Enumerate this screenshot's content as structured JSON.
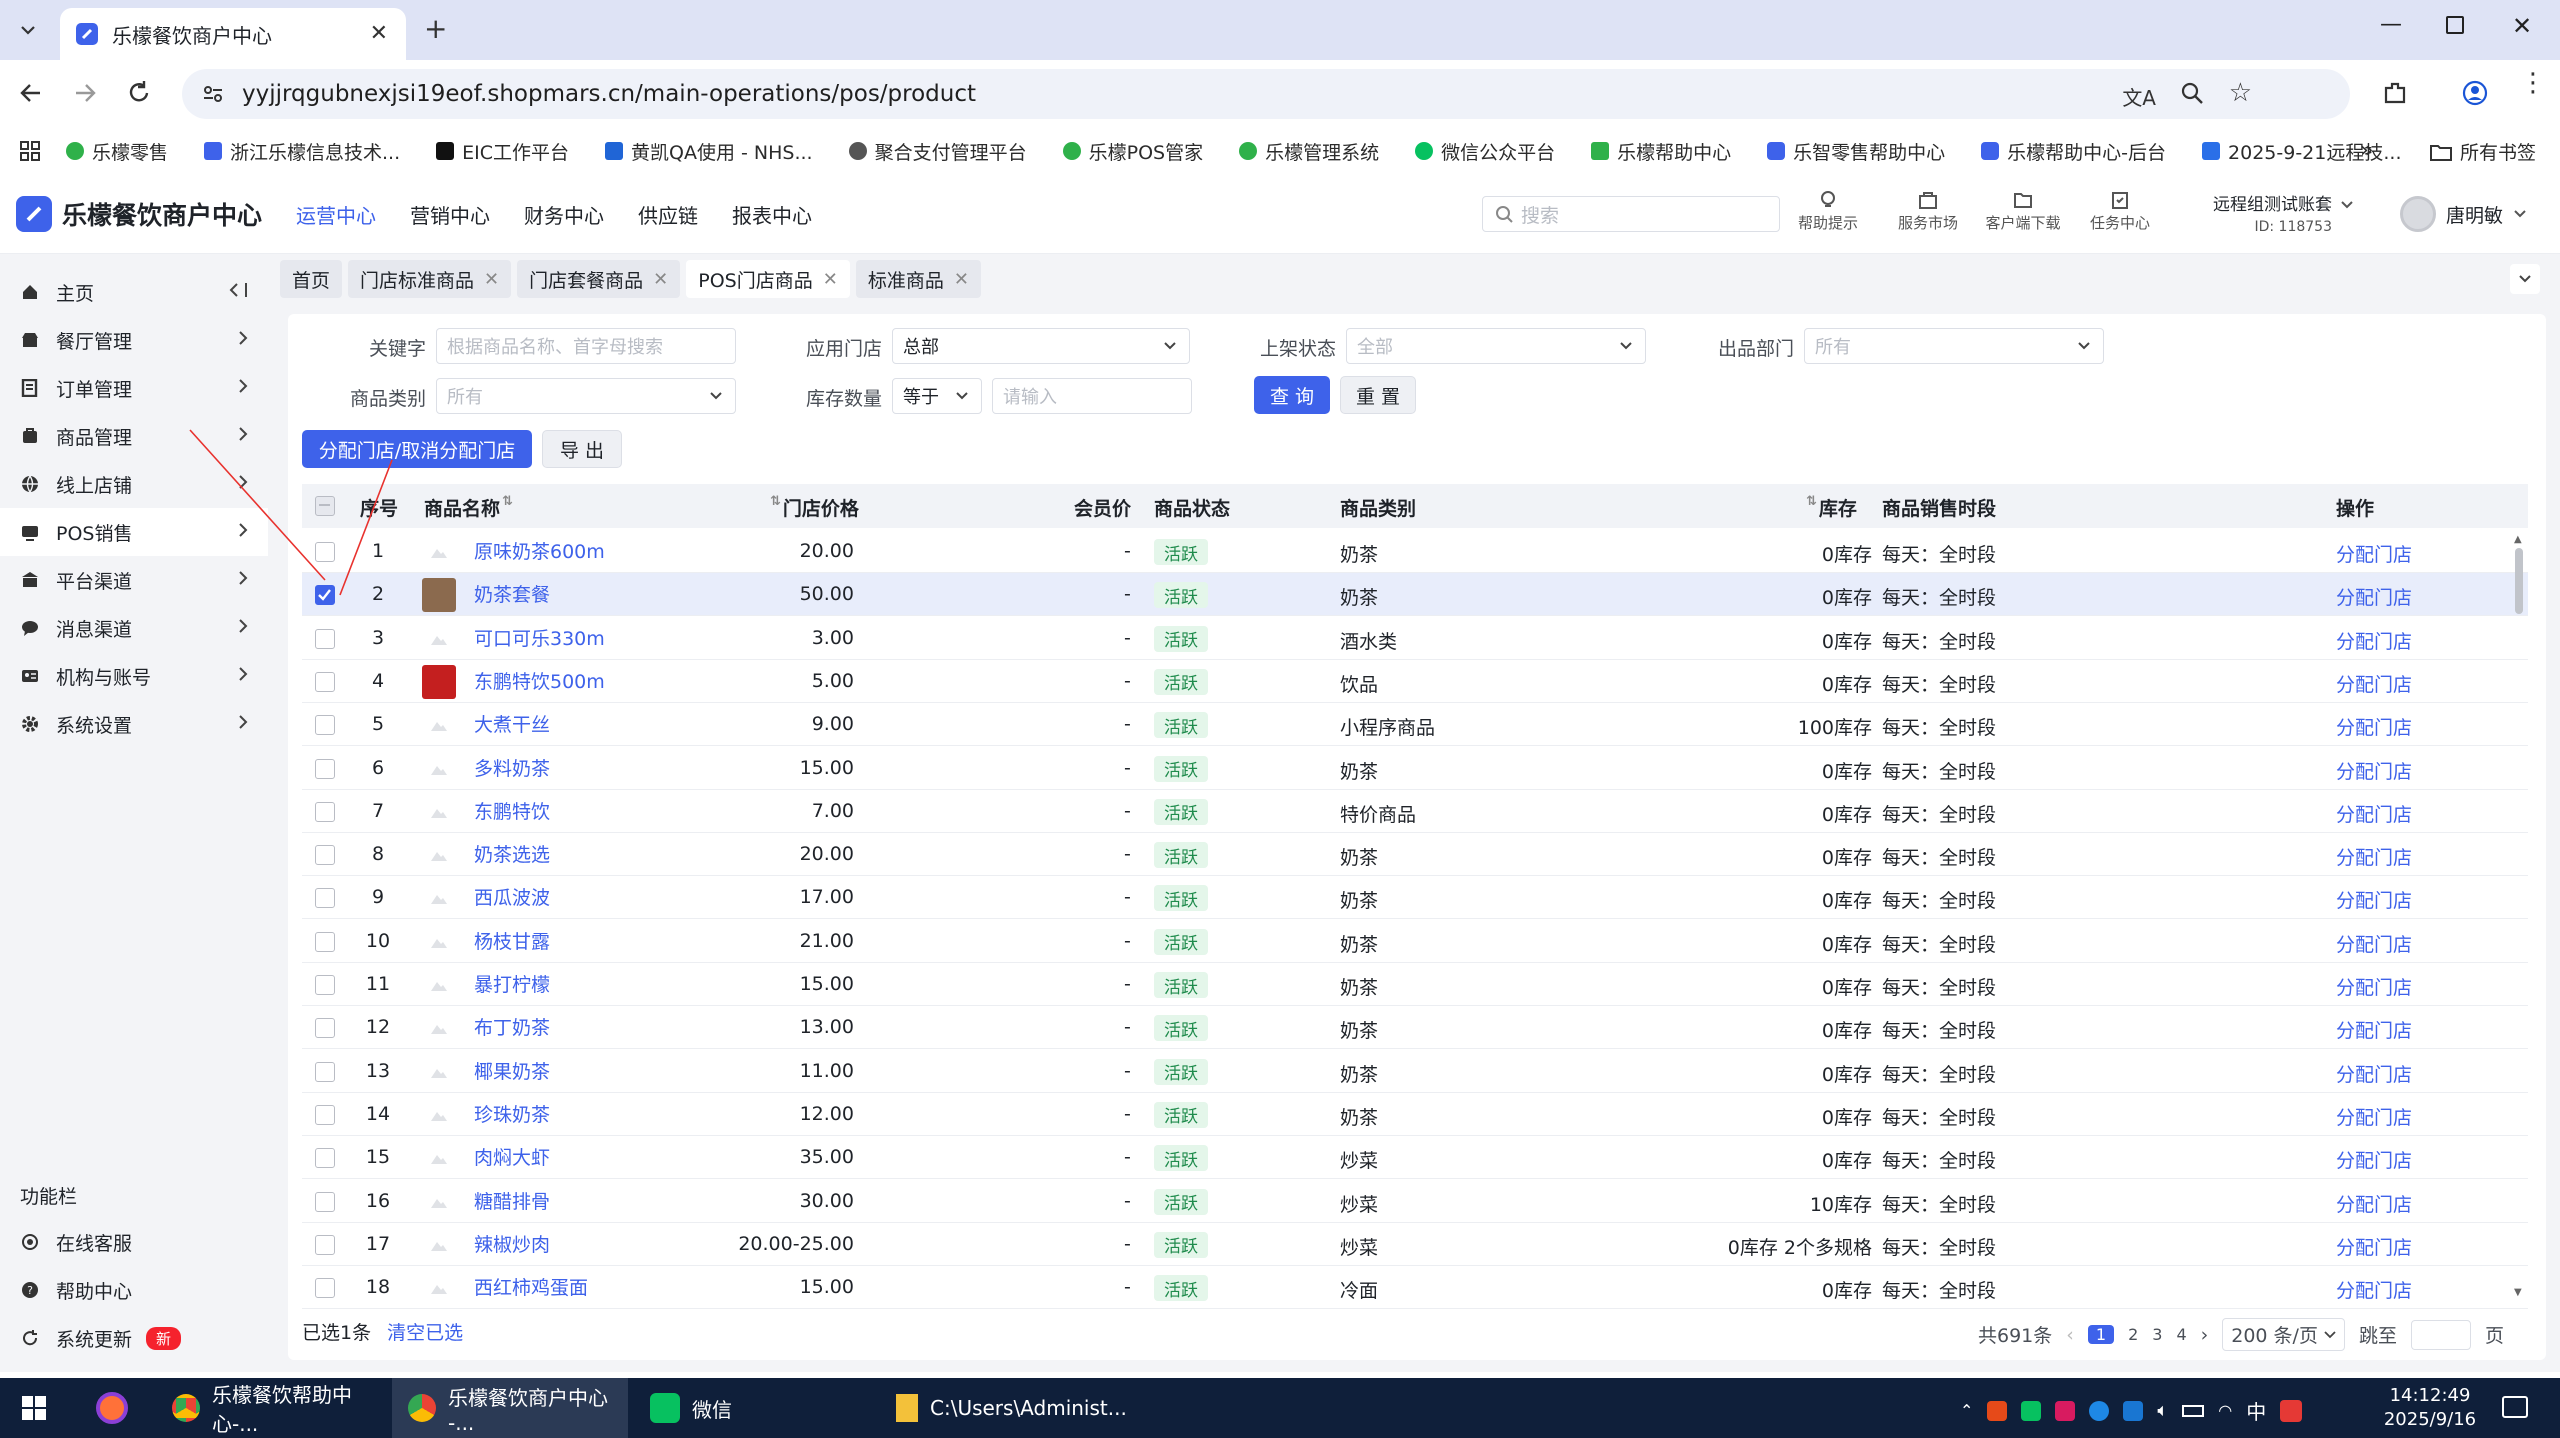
{
  "browser": {
    "tab_title": "乐檬餐饮商户中心",
    "url": "yyjjrqgubnexjsi19eof.shopmars.cn/main-operations/pos/product",
    "bookmarks": [
      "乐檬零售",
      "浙江乐檬信息技术...",
      "EIC工作平台",
      "黄凯QA使用 - NHS...",
      "聚合支付管理平台",
      "乐檬POS管家",
      "乐檬管理系统",
      "微信公众平台",
      "乐檬帮助中心",
      "乐智零售帮助中心",
      "乐檬帮助中心-后台",
      "2025-9-21远程技..."
    ],
    "all_bookmarks": "所有书签",
    "more": "»"
  },
  "app": {
    "logo": "乐檬餐饮商户中心",
    "nav": [
      "运营中心",
      "营销中心",
      "财务中心",
      "供应链",
      "报表中心"
    ],
    "search_placeholder": "搜索",
    "tools": [
      "帮助提示",
      "服务市场",
      "客户端下载",
      "任务中心"
    ],
    "account_name": "远程组测试账套",
    "account_id": "ID: 118753",
    "user": "唐明敏"
  },
  "sidebar": {
    "items": [
      "主页",
      "餐厅管理",
      "订单管理",
      "商品管理",
      "线上店铺",
      "POS销售",
      "平台渠道",
      "消息渠道",
      "机构与账号",
      "系统设置"
    ],
    "section": "功能栏",
    "extras": [
      "在线客服",
      "帮助中心",
      "系统更新"
    ],
    "new_badge": "新"
  },
  "page_tabs": [
    "首页",
    "门店标准商品",
    "门店套餐商品",
    "POS门店商品",
    "标准商品"
  ],
  "filters": {
    "keyword_label": "关键字",
    "keyword_placeholder": "根据商品名称、首字母搜索",
    "store_label": "应用门店",
    "store_value": "总部",
    "status_label": "上架状态",
    "status_value": "全部",
    "dept_label": "出品部门",
    "dept_value": "所有",
    "category_label": "商品类别",
    "category_value": "所有",
    "stock_label": "库存数量",
    "stock_op": "等于",
    "stock_placeholder": "请输入",
    "query": "查 询",
    "reset": "重 置"
  },
  "actions": {
    "assign": "分配门店/取消分配门店",
    "export": "导 出"
  },
  "table": {
    "headers": [
      "序号",
      "商品名称",
      "门店价格",
      "会员价",
      "商品状态",
      "商品类别",
      "库存",
      "商品销售时段",
      "操作"
    ],
    "rows": [
      {
        "no": "1",
        "name": "原味奶茶600m",
        "price": "20.00",
        "member": "-",
        "status": "活跃",
        "category": "奶茶",
        "stock": "0库存",
        "period": "每天：全时段",
        "op": "分配门店"
      },
      {
        "no": "2",
        "name": "奶茶套餐",
        "price": "50.00",
        "member": "-",
        "status": "活跃",
        "category": "奶茶",
        "stock": "0库存",
        "period": "每天：全时段",
        "op": "分配门店"
      },
      {
        "no": "3",
        "name": "可口可乐330m",
        "price": "3.00",
        "member": "-",
        "status": "活跃",
        "category": "酒水类",
        "stock": "0库存",
        "period": "每天：全时段",
        "op": "分配门店"
      },
      {
        "no": "4",
        "name": "东鹏特饮500m",
        "price": "5.00",
        "member": "-",
        "status": "活跃",
        "category": "饮品",
        "stock": "0库存",
        "period": "每天：全时段",
        "op": "分配门店"
      },
      {
        "no": "5",
        "name": "大煮干丝",
        "price": "9.00",
        "member": "-",
        "status": "活跃",
        "category": "小程序商品",
        "stock": "100库存",
        "period": "每天：全时段",
        "op": "分配门店"
      },
      {
        "no": "6",
        "name": "多料奶茶",
        "price": "15.00",
        "member": "-",
        "status": "活跃",
        "category": "奶茶",
        "stock": "0库存",
        "period": "每天：全时段",
        "op": "分配门店"
      },
      {
        "no": "7",
        "name": "东鹏特饮",
        "price": "7.00",
        "member": "-",
        "status": "活跃",
        "category": "特价商品",
        "stock": "0库存",
        "period": "每天：全时段",
        "op": "分配门店"
      },
      {
        "no": "8",
        "name": "奶茶选选",
        "price": "20.00",
        "member": "-",
        "status": "活跃",
        "category": "奶茶",
        "stock": "0库存",
        "period": "每天：全时段",
        "op": "分配门店"
      },
      {
        "no": "9",
        "name": "西瓜波波",
        "price": "17.00",
        "member": "-",
        "status": "活跃",
        "category": "奶茶",
        "stock": "0库存",
        "period": "每天：全时段",
        "op": "分配门店"
      },
      {
        "no": "10",
        "name": "杨枝甘露",
        "price": "21.00",
        "member": "-",
        "status": "活跃",
        "category": "奶茶",
        "stock": "0库存",
        "period": "每天：全时段",
        "op": "分配门店"
      },
      {
        "no": "11",
        "name": "暴打柠檬",
        "price": "15.00",
        "member": "-",
        "status": "活跃",
        "category": "奶茶",
        "stock": "0库存",
        "period": "每天：全时段",
        "op": "分配门店"
      },
      {
        "no": "12",
        "name": "布丁奶茶",
        "price": "13.00",
        "member": "-",
        "status": "活跃",
        "category": "奶茶",
        "stock": "0库存",
        "period": "每天：全时段",
        "op": "分配门店"
      },
      {
        "no": "13",
        "name": "椰果奶茶",
        "price": "11.00",
        "member": "-",
        "status": "活跃",
        "category": "奶茶",
        "stock": "0库存",
        "period": "每天：全时段",
        "op": "分配门店"
      },
      {
        "no": "14",
        "name": "珍珠奶茶",
        "price": "12.00",
        "member": "-",
        "status": "活跃",
        "category": "奶茶",
        "stock": "0库存",
        "period": "每天：全时段",
        "op": "分配门店"
      },
      {
        "no": "15",
        "name": "肉焖大虾",
        "price": "35.00",
        "member": "-",
        "status": "活跃",
        "category": "炒菜",
        "stock": "0库存",
        "period": "每天：全时段",
        "op": "分配门店"
      },
      {
        "no": "16",
        "name": "糖醋排骨",
        "price": "30.00",
        "member": "-",
        "status": "活跃",
        "category": "炒菜",
        "stock": "10库存",
        "period": "每天：全时段",
        "op": "分配门店"
      },
      {
        "no": "17",
        "name": "辣椒炒肉",
        "price": "20.00-25.00",
        "member": "-",
        "status": "活跃",
        "category": "炒菜",
        "stock": "0库存 2个多规格",
        "period": "每天：全时段",
        "op": "分配门店"
      },
      {
        "no": "18",
        "name": "西红柿鸡蛋面",
        "price": "15.00",
        "member": "-",
        "status": "活跃",
        "category": "冷面",
        "stock": "0库存",
        "period": "每天：全时段",
        "op": "分配门店"
      }
    ]
  },
  "footer": {
    "selected": "已选1条",
    "clear": "清空已选",
    "total": "共691条",
    "pages": [
      "1",
      "2",
      "3",
      "4"
    ],
    "page_size": "200 条/页",
    "goto": "跳至",
    "page_unit": "页"
  },
  "taskbar": {
    "items": [
      "乐檬餐饮帮助中心-...",
      "乐檬餐饮商户中心 -...",
      "微信",
      "C:\\Users\\Administ..."
    ],
    "time": "14:12:49",
    "date": "2025/9/16",
    "ime": "中"
  },
  "colors": {
    "accent": "#3e62ea",
    "status_bg": "#e4f6ea",
    "status_fg": "#1f8b4c",
    "badge_red": "#f5222d"
  }
}
